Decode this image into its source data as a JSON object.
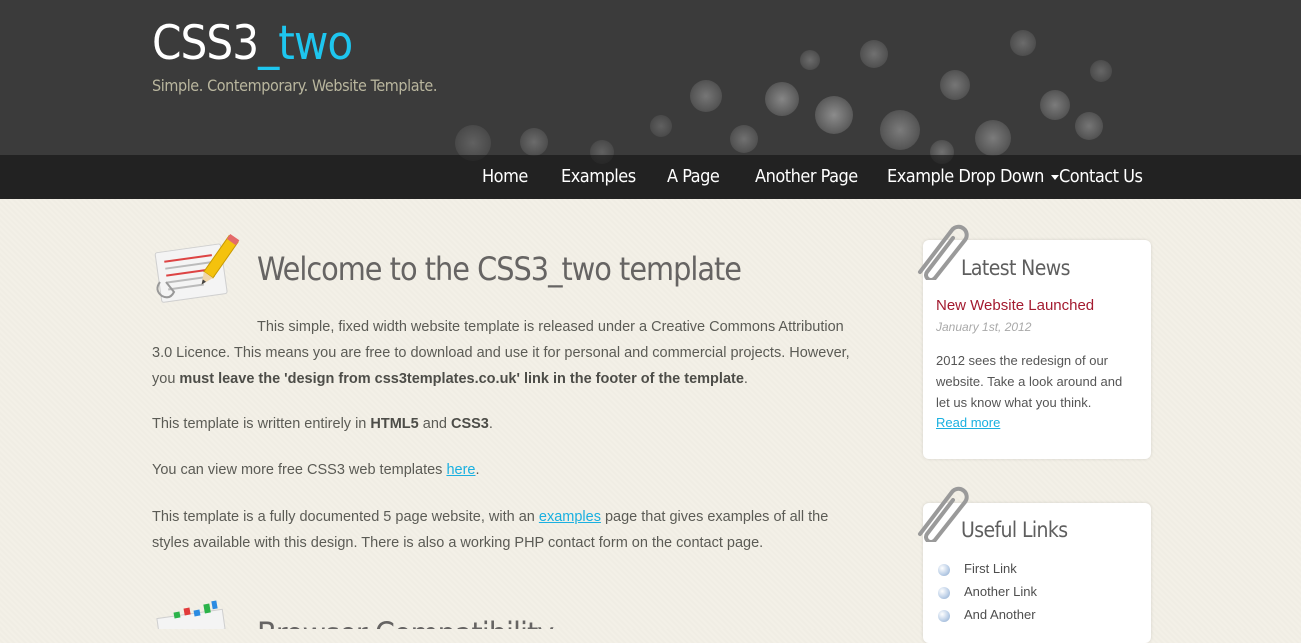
{
  "header": {
    "title_part1": "CSS3",
    "title_part2": "_two",
    "slogan": "Simple. Contemporary. Website Template."
  },
  "nav": {
    "items": [
      "Home",
      "Examples",
      "A Page",
      "Another Page",
      "Example Drop Down",
      "Contact Us"
    ]
  },
  "main": {
    "heading": "Welcome to the CSS3_two template",
    "p1_a": "This simple, fixed width website template is released under a Creative Commons Attribution 3.0 Licence. This means you are free to download and use it for personal and commercial projects. However, you ",
    "p1_bold": "must leave the 'design from css3templates.co.uk' link in the footer of the template",
    "p1_end": ".",
    "p2_a": "This template is written entirely in ",
    "p2_b1": "HTML5",
    "p2_and": " and ",
    "p2_b2": "CSS3",
    "p2_end": ".",
    "p3_a": "You can view more free CSS3 web templates ",
    "p3_link": "here",
    "p3_end": ".",
    "p4_a": "This template is a fully documented 5 page website, with an ",
    "p4_link": "examples",
    "p4_b": " page that gives examples of all the styles available with this design. There is also a working PHP contact form on the contact page.",
    "heading2_partial": "Browser Compatibility"
  },
  "sidebar": {
    "news_title": "Latest News",
    "news_headline": "New Website Launched",
    "news_date": "January 1st, 2012",
    "news_body": "2012 sees the redesign of our website. Take a look around and let us know what you think.",
    "news_more": "Read more",
    "links_title": "Useful Links",
    "links": [
      "First Link",
      "Another Link",
      "And Another"
    ]
  },
  "colors": {
    "accent": "#1ec6ef",
    "headline_red": "#a31a2f",
    "header_bg": "#3b3b3b"
  }
}
